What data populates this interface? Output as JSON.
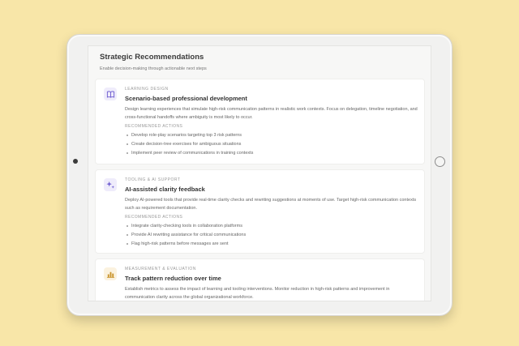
{
  "page": {
    "title": "Strategic Recommendations",
    "subtitle": "Enable decision-making through actionable next steps"
  },
  "cards": [
    {
      "category": "LEARNING DESIGN",
      "title": "Scenario-based professional development",
      "description": "Design learning experiences that simulate high-risk communication patterns in realistic work contexts. Focus on delegation, timeline negotiation, and cross-functional handoffs where ambiguity is most likely to occur.",
      "actions_label": "RECOMMENDED ACTIONS",
      "actions": [
        "Develop role-play scenarios targeting top 3 risk patterns",
        "Create decision-tree exercises for ambiguous situations",
        "Implement peer review of communications in training contexts"
      ],
      "icon": "book-icon",
      "icon_color": "#6d5bd0",
      "icon_bg": "#efecfb"
    },
    {
      "category": "TOOLING & AI SUPPORT",
      "title": "AI-assisted clarity feedback",
      "description": "Deploy AI-powered tools that provide real-time clarity checks and rewriting suggestions at moments of use. Target high-risk communication contexts such as requirement documentation.",
      "actions_label": "RECOMMENDED ACTIONS",
      "actions": [
        "Integrate clarity-checking tools in collaboration platforms",
        "Provide AI rewriting assistance for critical communications",
        "Flag high-risk patterns before messages are sent"
      ],
      "icon": "sparkle-icon",
      "icon_color": "#6d5bd0",
      "icon_bg": "#efecfb"
    },
    {
      "category": "MEASUREMENT & EVALUATION",
      "title": "Track pattern reduction over time",
      "description": "Establish metrics to assess the impact of learning and tooling interventions. Monitor reduction in high-risk patterns and improvement in communication clarity across the global organizational workforce.",
      "icon": "bar-chart-icon",
      "icon_color": "#c9932a",
      "icon_bg": "#fbf2df"
    }
  ]
}
